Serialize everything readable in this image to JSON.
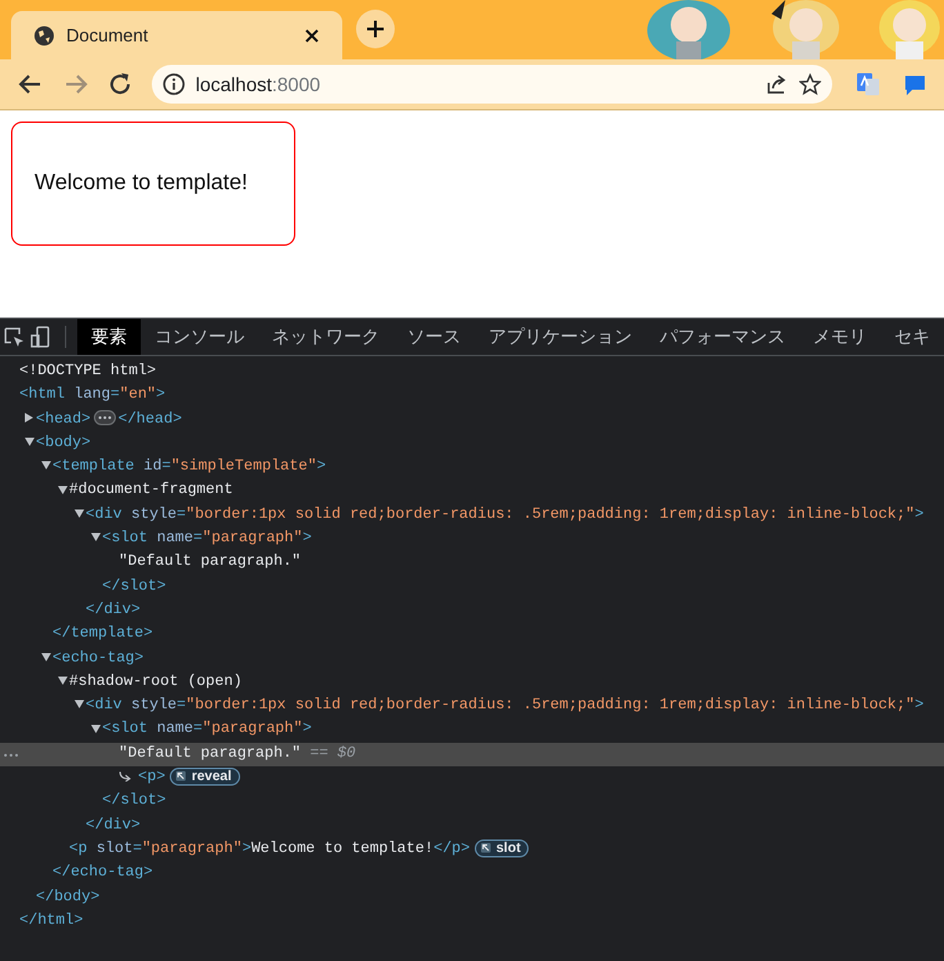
{
  "browser": {
    "tab": {
      "title": "Document"
    },
    "forward_disabled": true,
    "url": {
      "host": "localhost",
      "port": ":8000"
    }
  },
  "page": {
    "message": "Welcome to template!"
  },
  "devtools": {
    "tabs": [
      {
        "label": "要素",
        "selected": true
      },
      {
        "label": "コンソール",
        "selected": false
      },
      {
        "label": "ネットワーク",
        "selected": false
      },
      {
        "label": "ソース",
        "selected": false
      },
      {
        "label": "アプリケーション",
        "selected": false
      },
      {
        "label": "パフォーマンス",
        "selected": false
      },
      {
        "label": "メモリ",
        "selected": false
      },
      {
        "label": "セキ",
        "selected": false
      }
    ],
    "tree": [
      {
        "selected": false,
        "tokens": [
          {
            "kind": "doctype",
            "text": "<!DOCTYPE html>"
          }
        ]
      },
      {
        "selected": false,
        "tokens": [
          {
            "kind": "tag",
            "text": "<html "
          },
          {
            "kind": "attr",
            "text": "lang"
          },
          {
            "kind": "tag",
            "text": "="
          },
          {
            "kind": "value",
            "text": "\"en\""
          },
          {
            "kind": "tag",
            "text": ">"
          }
        ],
        "close": [
          {
            "kind": "tag",
            "text": "</html>"
          }
        ],
        "children": [
          {
            "selected": false,
            "expanded": false,
            "tokens": [
              {
                "kind": "tag",
                "text": "<head>"
              },
              {
                "kind": "more"
              },
              {
                "kind": "tag",
                "text": "</head>"
              }
            ]
          },
          {
            "selected": false,
            "expanded": true,
            "tokens": [
              {
                "kind": "tag",
                "text": "<body>"
              }
            ],
            "close": [
              {
                "kind": "tag",
                "text": "</body>"
              }
            ],
            "children": [
              {
                "selected": false,
                "expanded": true,
                "tokens": [
                  {
                    "kind": "tag",
                    "text": "<template "
                  },
                  {
                    "kind": "attr",
                    "text": "id"
                  },
                  {
                    "kind": "tag",
                    "text": "="
                  },
                  {
                    "kind": "value",
                    "text": "\"simpleTemplate\""
                  },
                  {
                    "kind": "tag",
                    "text": ">"
                  }
                ],
                "close": [
                  {
                    "kind": "tag",
                    "text": "</template>"
                  }
                ],
                "children": [
                  {
                    "selected": false,
                    "expanded": true,
                    "tokens": [
                      {
                        "kind": "text",
                        "text": "#document-fragment"
                      }
                    ],
                    "children": [
                      {
                        "selected": false,
                        "expanded": true,
                        "tokens": [
                          {
                            "kind": "tag",
                            "text": "<div "
                          },
                          {
                            "kind": "attr",
                            "text": "style"
                          },
                          {
                            "kind": "tag",
                            "text": "="
                          },
                          {
                            "kind": "value",
                            "text": "\"border:1px solid red;border-radius: .5rem;padding: 1rem;display: inline-block;\""
                          },
                          {
                            "kind": "tag",
                            "text": ">"
                          }
                        ],
                        "close": [
                          {
                            "kind": "tag",
                            "text": "</div>"
                          }
                        ],
                        "children": [
                          {
                            "selected": false,
                            "expanded": true,
                            "tokens": [
                              {
                                "kind": "tag",
                                "text": "<slot "
                              },
                              {
                                "kind": "attr",
                                "text": "name"
                              },
                              {
                                "kind": "tag",
                                "text": "="
                              },
                              {
                                "kind": "value",
                                "text": "\"paragraph\""
                              },
                              {
                                "kind": "tag",
                                "text": ">"
                              }
                            ],
                            "close": [
                              {
                                "kind": "tag",
                                "text": "</slot>"
                              }
                            ],
                            "children": [
                              {
                                "selected": false,
                                "tokens": [
                                  {
                                    "kind": "text",
                                    "text": "\"Default paragraph.\""
                                  }
                                ]
                              }
                            ]
                          }
                        ]
                      }
                    ]
                  }
                ]
              },
              {
                "selected": false,
                "expanded": true,
                "tokens": [
                  {
                    "kind": "tag",
                    "text": "<echo-tag>"
                  }
                ],
                "close": [
                  {
                    "kind": "tag",
                    "text": "</echo-tag>"
                  }
                ],
                "children": [
                  {
                    "selected": false,
                    "expanded": true,
                    "tokens": [
                      {
                        "kind": "text",
                        "text": "#shadow-root (open)"
                      }
                    ],
                    "children": [
                      {
                        "selected": false,
                        "expanded": true,
                        "tokens": [
                          {
                            "kind": "tag",
                            "text": "<div "
                          },
                          {
                            "kind": "attr",
                            "text": "style"
                          },
                          {
                            "kind": "tag",
                            "text": "="
                          },
                          {
                            "kind": "value",
                            "text": "\"border:1px solid red;border-radius: .5rem;padding: 1rem;display: inline-block;\""
                          },
                          {
                            "kind": "tag",
                            "text": ">"
                          }
                        ],
                        "close": [
                          {
                            "kind": "tag",
                            "text": "</div>"
                          }
                        ],
                        "children": [
                          {
                            "selected": false,
                            "expanded": true,
                            "tokens": [
                              {
                                "kind": "tag",
                                "text": "<slot "
                              },
                              {
                                "kind": "attr",
                                "text": "name"
                              },
                              {
                                "kind": "tag",
                                "text": "="
                              },
                              {
                                "kind": "value",
                                "text": "\"paragraph\""
                              },
                              {
                                "kind": "tag",
                                "text": ">"
                              }
                            ],
                            "close": [
                              {
                                "kind": "tag",
                                "text": "</slot>"
                              }
                            ],
                            "children": [
                              {
                                "selected": true,
                                "tokens": [
                                  {
                                    "kind": "text",
                                    "text": "\"Default paragraph.\""
                                  },
                                  {
                                    "kind": "hint",
                                    "text": " == $0"
                                  }
                                ]
                              },
                              {
                                "selected": false,
                                "tokens": [
                                  {
                                    "kind": "link"
                                  },
                                  {
                                    "kind": "tag",
                                    "text": "<p>"
                                  },
                                  {
                                    "kind": "badge",
                                    "text": "reveal"
                                  }
                                ]
                              }
                            ]
                          }
                        ]
                      }
                    ]
                  },
                  {
                    "selected": false,
                    "tokens": [
                      {
                        "kind": "tag",
                        "text": "<p "
                      },
                      {
                        "kind": "attr",
                        "text": "slot"
                      },
                      {
                        "kind": "tag",
                        "text": "="
                      },
                      {
                        "kind": "value",
                        "text": "\"paragraph\""
                      },
                      {
                        "kind": "tag",
                        "text": ">"
                      },
                      {
                        "kind": "text",
                        "text": "Welcome to template!"
                      },
                      {
                        "kind": "tag",
                        "text": "</p>"
                      },
                      {
                        "kind": "badge",
                        "text": "slot"
                      }
                    ]
                  }
                ]
              }
            ]
          }
        ]
      }
    ]
  }
}
